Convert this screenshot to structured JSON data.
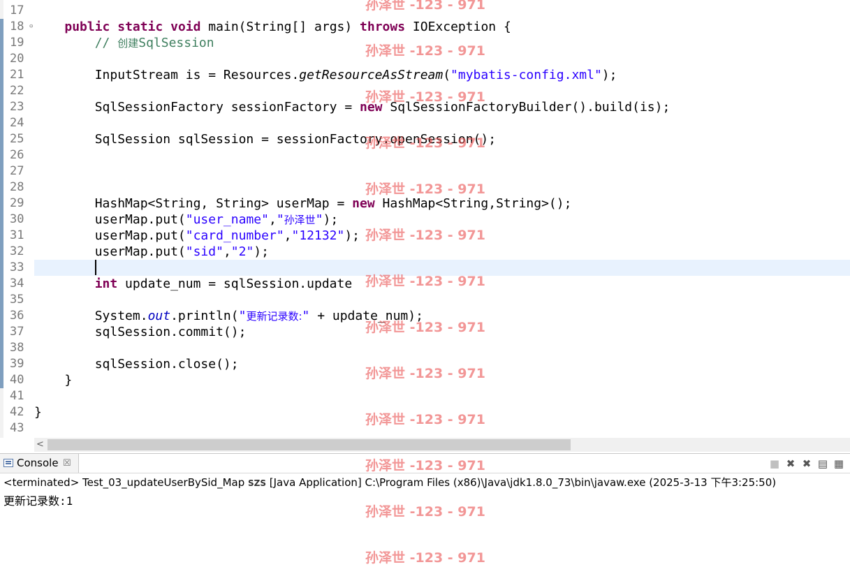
{
  "editor": {
    "line_numbers": [
      "17",
      "18",
      "19",
      "20",
      "21",
      "22",
      "23",
      "24",
      "25",
      "26",
      "27",
      "28",
      "29",
      "30",
      "31",
      "32",
      "33",
      "34",
      "35",
      "36",
      "37",
      "38",
      "39",
      "40",
      "41",
      "42",
      "43"
    ],
    "lines": [
      {
        "segments": []
      },
      {
        "segments": [
          {
            "t": "    "
          },
          {
            "t": "public",
            "c": "kw"
          },
          {
            "t": " "
          },
          {
            "t": "static",
            "c": "kw"
          },
          {
            "t": " "
          },
          {
            "t": "void",
            "c": "kw"
          },
          {
            "t": " main(String[] args) "
          },
          {
            "t": "throws",
            "c": "kw"
          },
          {
            "t": " IOException {"
          }
        ]
      },
      {
        "segments": [
          {
            "t": "        "
          },
          {
            "t": "// ",
            "c": "cm"
          },
          {
            "t": "创建",
            "c": "cm cjk"
          },
          {
            "t": "SqlSession",
            "c": "cm"
          }
        ]
      },
      {
        "segments": []
      },
      {
        "segments": [
          {
            "t": "        InputStream is = Resources."
          },
          {
            "t": "getResourceAsStream",
            "c": "it"
          },
          {
            "t": "("
          },
          {
            "t": "\"mybatis-config.xml\"",
            "c": "str"
          },
          {
            "t": ");"
          }
        ]
      },
      {
        "segments": []
      },
      {
        "segments": [
          {
            "t": "        SqlSessionFactory sessionFactory = "
          },
          {
            "t": "new",
            "c": "kw"
          },
          {
            "t": " SqlSessionFactoryBuilder().build(is);"
          }
        ]
      },
      {
        "segments": []
      },
      {
        "segments": [
          {
            "t": "        SqlSession sqlSession = sessionFactory.openSession();"
          }
        ]
      },
      {
        "segments": []
      },
      {
        "segments": []
      },
      {
        "segments": []
      },
      {
        "segments": [
          {
            "t": "        HashMap<String, String> userMap = "
          },
          {
            "t": "new",
            "c": "kw"
          },
          {
            "t": " HashMap<String,String>();"
          }
        ]
      },
      {
        "segments": [
          {
            "t": "        userMap.put("
          },
          {
            "t": "\"user_name\"",
            "c": "str"
          },
          {
            "t": ","
          },
          {
            "t": "\"",
            "c": "str"
          },
          {
            "t": "孙泽世",
            "c": "str cjk"
          },
          {
            "t": "\"",
            "c": "str"
          },
          {
            "t": ");"
          }
        ]
      },
      {
        "segments": [
          {
            "t": "        userMap.put("
          },
          {
            "t": "\"card_number\"",
            "c": "str"
          },
          {
            "t": ","
          },
          {
            "t": "\"12132\"",
            "c": "str"
          },
          {
            "t": ");"
          }
        ]
      },
      {
        "segments": [
          {
            "t": "        userMap.put("
          },
          {
            "t": "\"sid\"",
            "c": "str"
          },
          {
            "t": ","
          },
          {
            "t": "\"2\"",
            "c": "str"
          },
          {
            "t": ");"
          }
        ]
      },
      {
        "segments": [],
        "current": true
      },
      {
        "segments": [
          {
            "t": "        "
          },
          {
            "t": "int",
            "c": "kw"
          },
          {
            "t": " update_num = sqlSession.update"
          }
        ]
      },
      {
        "segments": []
      },
      {
        "segments": [
          {
            "t": "        System."
          },
          {
            "t": "out",
            "c": "fld"
          },
          {
            "t": ".println("
          },
          {
            "t": "\"",
            "c": "str"
          },
          {
            "t": "更新记录数:",
            "c": "str cjk"
          },
          {
            "t": "\"",
            "c": "str"
          },
          {
            "t": " + update_num);"
          }
        ]
      },
      {
        "segments": [
          {
            "t": "        sqlSession.commit();"
          }
        ]
      },
      {
        "segments": []
      },
      {
        "segments": [
          {
            "t": "        sqlSession.close();"
          }
        ]
      },
      {
        "segments": [
          {
            "t": "    }"
          }
        ]
      },
      {
        "segments": []
      },
      {
        "segments": [
          {
            "t": "}"
          }
        ]
      },
      {
        "segments": []
      }
    ]
  },
  "scrollbar": {
    "left_arrow": "<"
  },
  "console": {
    "tab_label": "Console",
    "tab_close": "☒",
    "status_prefix": "<terminated> Test_03_updateUserBySid_Map",
    "status_user": "SZS",
    "status_suffix": " [Java Application] C:\\Program Files (x86)\\Java\\jdk1.8.0_73\\bin\\javaw.exe (2025-3-13 下午3:25:50)",
    "output": "更新记录数:1",
    "tools": [
      "■",
      "✖",
      "✖",
      "▤",
      "▦"
    ]
  },
  "watermark": {
    "text": "孙泽世 -123 - 971",
    "count": 13
  }
}
